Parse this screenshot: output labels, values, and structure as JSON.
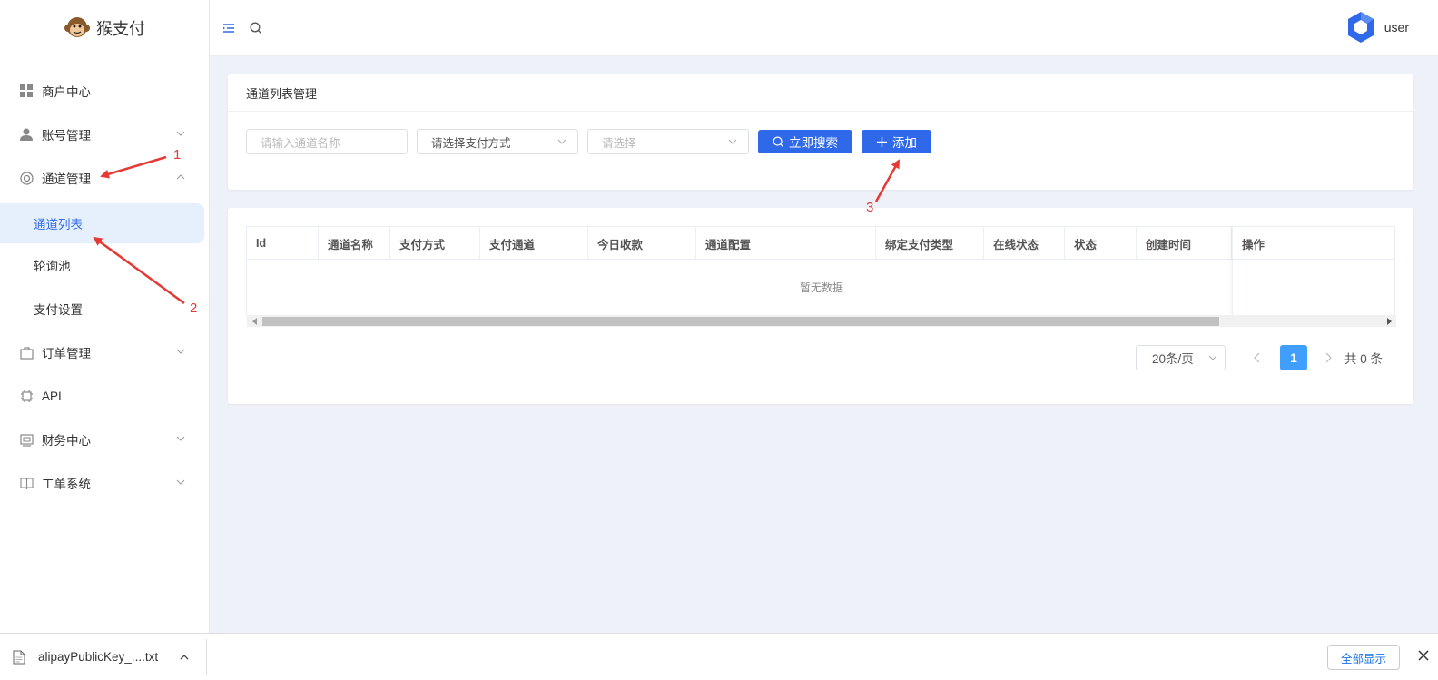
{
  "app": {
    "logo_text": "猴支付"
  },
  "header": {
    "user_name": "user"
  },
  "sidebar": {
    "items": [
      {
        "label": "商户中心",
        "icon": "grid-icon"
      },
      {
        "label": "账号管理",
        "icon": "user-icon"
      },
      {
        "label": "通道管理",
        "icon": "lifebuoy-icon"
      },
      {
        "label": "订单管理",
        "icon": "bag-icon"
      },
      {
        "label": "API",
        "icon": "chip-icon"
      },
      {
        "label": "财务中心",
        "icon": "wallet-icon"
      },
      {
        "label": "工单系统",
        "icon": "book-icon"
      }
    ],
    "sub_items": [
      {
        "label": "通道列表",
        "active": true
      },
      {
        "label": "轮询池"
      },
      {
        "label": "支付设置"
      }
    ]
  },
  "panel": {
    "title": "通道列表管理",
    "filters": {
      "name_placeholder": "请输入通道名称",
      "pay_method": "请选择支付方式",
      "select_placeholder": "请选择"
    },
    "buttons": {
      "search": "立即搜索",
      "add": "添加"
    }
  },
  "table": {
    "columns": [
      "Id",
      "通道名称",
      "支付方式",
      "支付通道",
      "今日收款",
      "通道配置",
      "绑定支付类型",
      "在线状态",
      "状态",
      "创建时间",
      "操作"
    ],
    "empty_text": "暂无数据"
  },
  "pagination": {
    "page_size": "20条/页",
    "current_page": "1",
    "total": "共 0 条"
  },
  "annotations": {
    "n1": "1",
    "n2": "2",
    "n3": "3",
    "color": "#e53935"
  },
  "download_bar": {
    "file_name": "alipayPublicKey_....txt",
    "show_all": "全部显示"
  },
  "colors": {
    "primary": "#2f69e9",
    "page_active": "#409eff",
    "bg": "#eef1f7"
  }
}
